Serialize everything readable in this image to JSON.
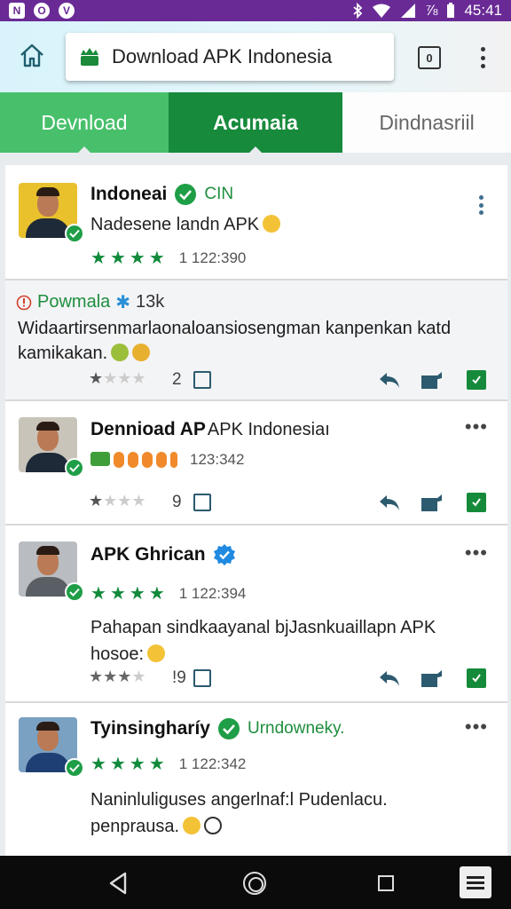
{
  "status_bar": {
    "left_icons": [
      "N",
      "O",
      "V"
    ],
    "time": "45:41",
    "battery": "⅞"
  },
  "browser": {
    "url_title": "Download APK Indonesia",
    "tab_count": "0"
  },
  "tabs": [
    "Devnload",
    "Acumaia",
    "Dindnasriil"
  ],
  "posts": [
    {
      "name": "Indoneai",
      "tag": "CIN",
      "subtitle": "Nadesene landn APK",
      "rating_text": "1 122:390",
      "stars": 4
    },
    {
      "name": "Powmala",
      "meta": "13k",
      "text": "Widaartirsenmarlaonaloansiosengman kanpenkan katd kamikakan.",
      "count": "2",
      "stars_filled": 1
    },
    {
      "name": "Dennioad AP",
      "name_suffix": "APK Indonesiaı",
      "subtitle": "123:342",
      "count": "9",
      "stars_filled": 1
    },
    {
      "name": "APK Ghrican",
      "rating_text": "1 122:394",
      "text": "Pahapan sindkaayanal bjJasnkuaillapn APK hosoe:",
      "count": "!9",
      "stars": 4,
      "stars_filled": 3
    },
    {
      "name": "Tyinsingharíy",
      "tag": "Urndowneky.",
      "rating_text": "1 122:342",
      "text": "Naninluliguses angerlnaf:l Pudenlacu. penprausa.",
      "stars": 4
    }
  ]
}
